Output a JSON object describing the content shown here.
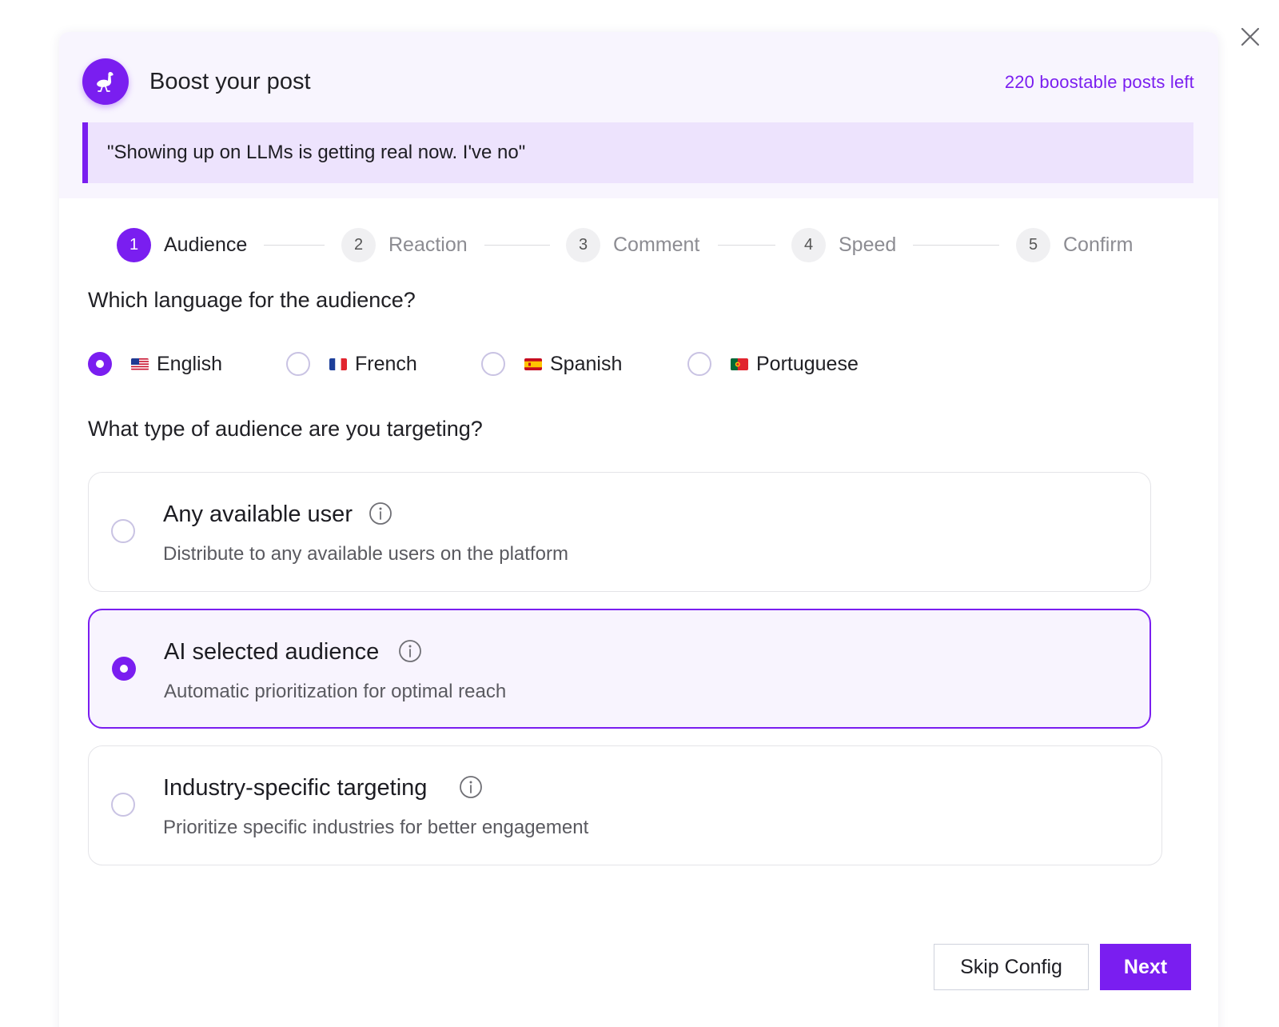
{
  "header": {
    "title": "Boost your post",
    "posts_left": "220 boostable posts left",
    "quote": "\"Showing up on LLMs is getting real now. I've no\""
  },
  "stepper": {
    "steps": [
      {
        "number": "1",
        "label": "Audience",
        "active": true
      },
      {
        "number": "2",
        "label": "Reaction",
        "active": false
      },
      {
        "number": "3",
        "label": "Comment",
        "active": false
      },
      {
        "number": "4",
        "label": "Speed",
        "active": false
      },
      {
        "number": "5",
        "label": "Confirm",
        "active": false
      }
    ]
  },
  "language_section": {
    "question": "Which language for the audience?",
    "options": [
      {
        "label": "English",
        "flag": "us-flag-icon",
        "selected": true
      },
      {
        "label": "French",
        "flag": "fr-flag-icon",
        "selected": false
      },
      {
        "label": "Spanish",
        "flag": "es-flag-icon",
        "selected": false
      },
      {
        "label": "Portuguese",
        "flag": "pt-flag-icon",
        "selected": false
      }
    ]
  },
  "audience_section": {
    "question": "What type of audience are you targeting?",
    "options": [
      {
        "title": "Any available user",
        "description": "Distribute to any available users on the platform",
        "selected": false
      },
      {
        "title": "AI selected audience",
        "description": "Automatic prioritization for optimal reach",
        "selected": true
      },
      {
        "title": "Industry-specific targeting",
        "description": "Prioritize specific industries for better engagement",
        "selected": false
      }
    ]
  },
  "footer": {
    "skip_label": "Skip Config",
    "next_label": "Next"
  },
  "colors": {
    "accent": "#7a1ef0",
    "header_bg": "#f8f5fe",
    "quote_bg": "#ede3fd"
  },
  "icons": {
    "close": "close-icon",
    "brand": "ostrich-logo-icon",
    "info": "info-icon"
  }
}
